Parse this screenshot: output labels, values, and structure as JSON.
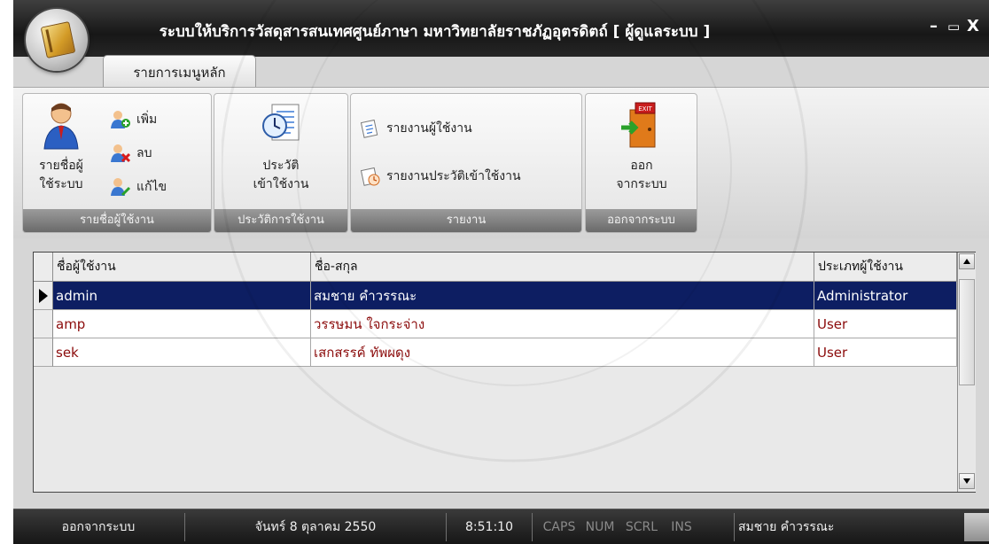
{
  "window": {
    "title": "ระบบให้บริการวัสดุสารสนเทศศูนย์ภาษา มหาวิทยาลัยราชภัฏอุตรดิตถ์ [ ผู้ดูแลระบบ ]",
    "controls": {
      "minimize": "–",
      "maximize": "▭",
      "close": "X"
    }
  },
  "ribbon": {
    "tab": "รายการเมนูหลัก",
    "groups": {
      "users": {
        "caption": "รายชื่อผู้ใช้งาน",
        "big_button": {
          "line1": "รายชื่อผู้",
          "line2": "ใช้ระบบ"
        },
        "add": "เพิ่ม",
        "delete": "ลบ",
        "edit": "แก้ไข"
      },
      "history": {
        "caption": "ประวัติการใช้งาน",
        "big_button": {
          "line1": "ประวัติ",
          "line2": "เข้าใช้งาน"
        }
      },
      "reports": {
        "caption": "รายงาน",
        "user_report": "รายงานผู้ใช้งาน",
        "history_report": "รายงานประวัติเข้าใช้งาน"
      },
      "exit": {
        "caption": "ออกจากระบบ",
        "big_button": {
          "line1": "ออก",
          "line2": "จากระบบ"
        },
        "sign_text": "EXIT"
      }
    }
  },
  "grid": {
    "columns": [
      "ชื่อผู้ใช้งาน",
      "ชื่อ-สกุล",
      "ประเภทผู้ใช้งาน"
    ],
    "rows": [
      {
        "username": "admin",
        "fullname": "สมชาย คำวรรณะ",
        "type": "Administrator",
        "selected": true
      },
      {
        "username": "amp",
        "fullname": "วรรษมน ใจกระจ่าง",
        "type": "User",
        "selected": false
      },
      {
        "username": "sek",
        "fullname": "เสกสรรค์ ทัพผดุง",
        "type": "User",
        "selected": false
      }
    ]
  },
  "statusbar": {
    "exit_label": "ออกจากระบบ",
    "date": "จันทร์ 8 ตุลาคม 2550",
    "time": "8:51:10",
    "caps": "CAPS",
    "num": "NUM",
    "scrl": "SCRL",
    "ins": "INS",
    "user": "สมชาย คำวรรณะ"
  },
  "colors": {
    "selected_row_bg": "#0d1e62",
    "row_text": "#8b0b0b",
    "titlebar": "#171717"
  }
}
